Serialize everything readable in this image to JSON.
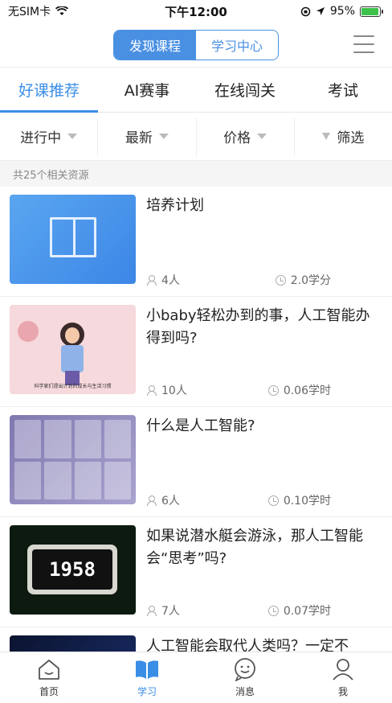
{
  "status_bar": {
    "carrier": "无SIM卡",
    "time": "下午12:00",
    "battery": "95%",
    "battery_level": 0.95
  },
  "header": {
    "segments": [
      {
        "label": "发现课程",
        "active": true
      },
      {
        "label": "学习中心",
        "active": false
      }
    ]
  },
  "tabs": [
    {
      "label": "好课推荐",
      "active": true
    },
    {
      "label": "AI赛事"
    },
    {
      "label": "在线闯关"
    },
    {
      "label": "考试"
    }
  ],
  "filters": {
    "status": "进行中",
    "sort": "最新",
    "price": "价格",
    "filter": "筛选"
  },
  "count_text": "共25个相关资源",
  "courses": [
    {
      "title": "培养计划",
      "people": "4人",
      "credit": "2.0学分"
    },
    {
      "title": "小baby轻松办到的事，人工智能办得到吗?",
      "people": "10人",
      "credit": "0.06学时",
      "thumb_caption": "科学家们提出计划的成长与生活习惯"
    },
    {
      "title": "什么是人工智能?",
      "people": "6人",
      "credit": "0.10学时"
    },
    {
      "title": "如果说潜水艇会游泳，那人工智能会“思考”吗?",
      "people": "7人",
      "credit": "0.07学时",
      "thumb_text": "1958"
    },
    {
      "title": "人工智能会取代人类吗？一定不"
    }
  ],
  "bottom_nav": [
    {
      "label": "首页",
      "icon": "home-icon"
    },
    {
      "label": "学习",
      "icon": "book-icon",
      "active": true
    },
    {
      "label": "消息",
      "icon": "message-icon"
    },
    {
      "label": "我",
      "icon": "profile-icon"
    }
  ],
  "colors": {
    "accent": "#3a8ee6"
  }
}
